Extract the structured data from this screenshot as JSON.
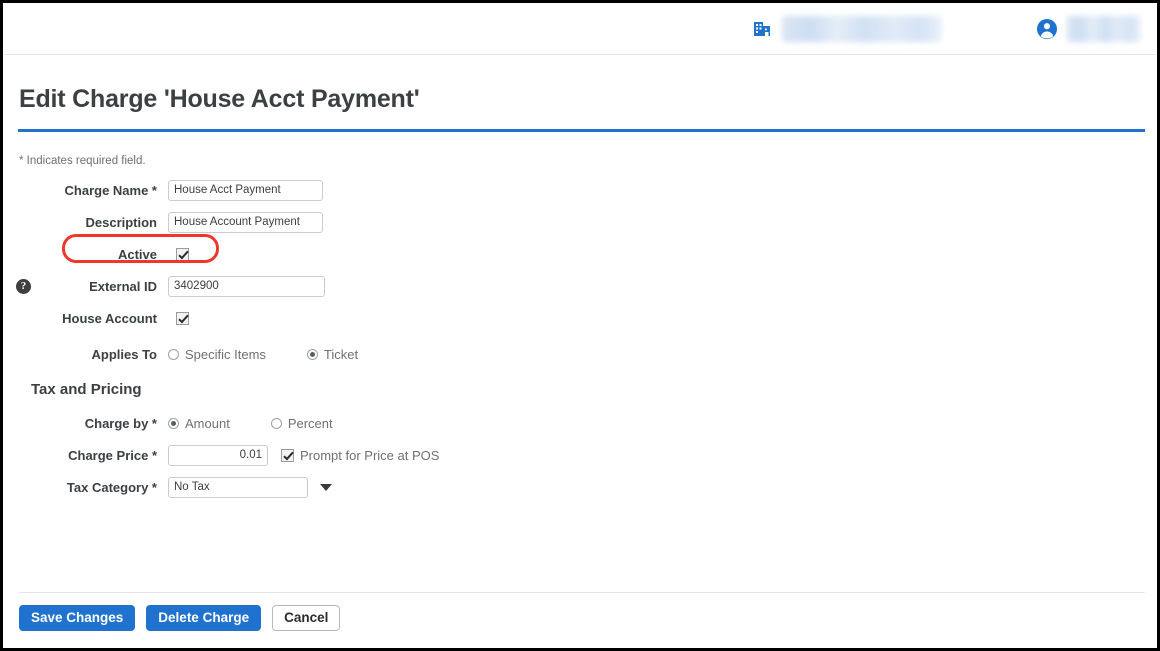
{
  "header": {
    "company_icon": "building-icon",
    "company_name_redacted": "",
    "account_icon": "user-account-icon",
    "account_name_redacted": ""
  },
  "page": {
    "title": "Edit Charge 'House Acct Payment'",
    "required_note": "* Indicates required field.",
    "accent_color": "#1f72cd",
    "highlight_color": "#f0372b"
  },
  "form": {
    "charge_name": {
      "label": "Charge Name *",
      "value": "House Acct Payment"
    },
    "description": {
      "label": "Description",
      "value": "House Account Payment"
    },
    "active": {
      "label": "Active",
      "checked": true
    },
    "external_id": {
      "label": "External ID",
      "value": "3402900",
      "help_icon": "help-question-icon"
    },
    "house_account": {
      "label": "House Account",
      "checked": true
    },
    "applies_to": {
      "label": "Applies To",
      "options": [
        {
          "label": "Specific Items",
          "selected": false
        },
        {
          "label": "Ticket",
          "selected": true
        }
      ]
    }
  },
  "tax_and_pricing": {
    "heading": "Tax and Pricing",
    "charge_by": {
      "label": "Charge by *",
      "options": [
        {
          "label": "Amount",
          "selected": true
        },
        {
          "label": "Percent",
          "selected": false
        }
      ]
    },
    "charge_price": {
      "label": "Charge Price *",
      "value": "0.01",
      "prompt_label": "Prompt for Price at POS",
      "prompt_checked": true
    },
    "tax_category": {
      "label": "Tax Category *",
      "value": "No Tax"
    }
  },
  "footer": {
    "save_label": "Save Changes",
    "delete_label": "Delete Charge",
    "cancel_label": "Cancel"
  }
}
